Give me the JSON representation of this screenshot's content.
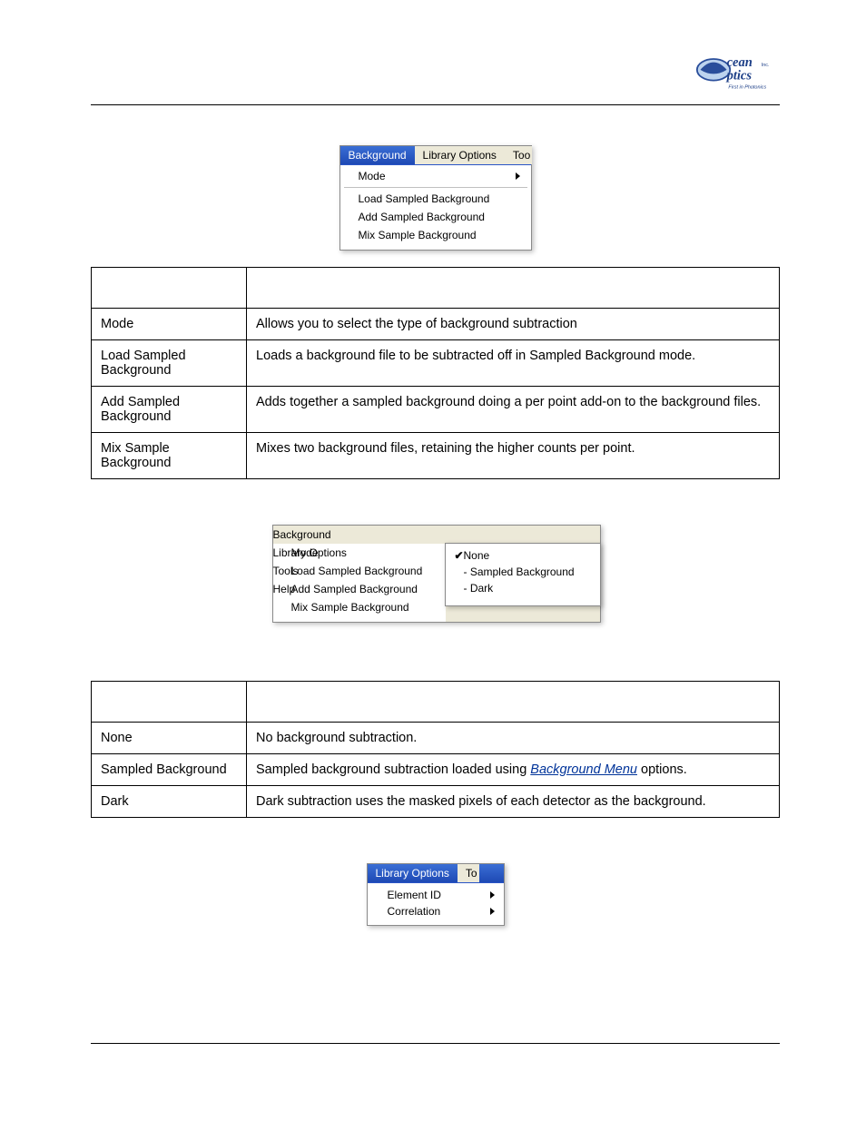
{
  "logo": {
    "line1": "cean",
    "line2": "ptics",
    "suffix": "Inc."
  },
  "menu1": {
    "tabs": {
      "active": "Background",
      "inactive": "Library Options",
      "cut": "Too"
    },
    "mode": "Mode",
    "items": [
      "Load Sampled Background",
      "Add Sampled Background",
      "Mix Sample Background"
    ]
  },
  "table1": {
    "rows": [
      {
        "k": "Mode",
        "v": "Allows you to select the type of background subtraction"
      },
      {
        "k": "Load Sampled Background",
        "v": "Loads a background file to be subtracted off in Sampled Background mode."
      },
      {
        "k": "Add Sampled Background",
        "v": "Adds together a sampled background doing a per point add-on to the background files."
      },
      {
        "k": "Mix Sample Background",
        "v": "Mixes two background files, retaining the higher counts per point."
      }
    ]
  },
  "menu2": {
    "tabs": {
      "active": "Background",
      "others": [
        "Library Options",
        "Tools",
        "Help"
      ]
    },
    "mode": "Mode",
    "items": [
      "Load Sampled Background",
      "Add Sampled Background",
      "Mix Sample Background"
    ],
    "submenu": {
      "checked": "None",
      "items": [
        "- Sampled Background",
        "- Dark"
      ]
    }
  },
  "table2": {
    "rows": [
      {
        "k": "None",
        "v": "No background subtraction."
      },
      {
        "k": "Sampled Background",
        "v_pre": "Sampled background subtraction loaded using ",
        "link": "Background Menu",
        "v_post": " options."
      },
      {
        "k": "Dark",
        "v": "Dark subtraction uses the masked pixels of each detector as the background."
      }
    ]
  },
  "menu3": {
    "tabs": {
      "active": "Library Options",
      "cut": "To"
    },
    "items": [
      "Element  ID",
      "Correlation"
    ]
  }
}
